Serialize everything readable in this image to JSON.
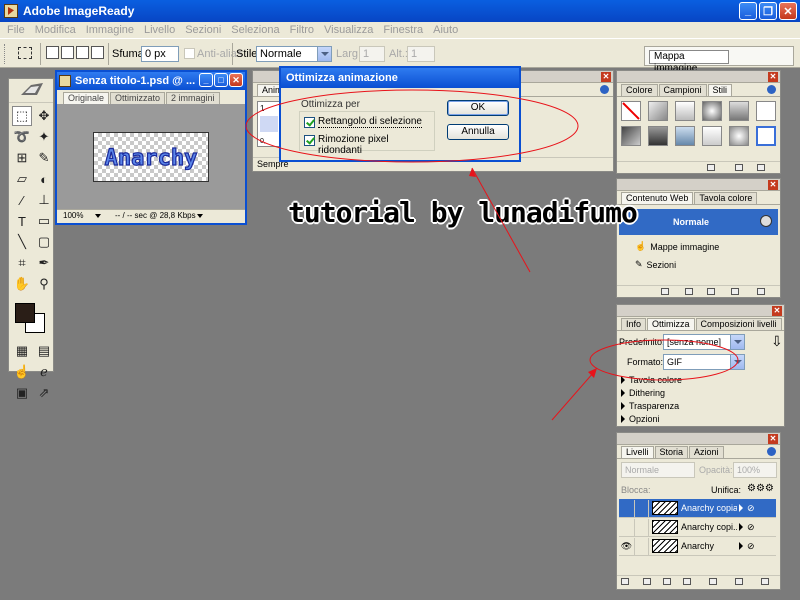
{
  "app": {
    "title": "Adobe ImageReady"
  },
  "menu": [
    "File",
    "Modifica",
    "Immagine",
    "Livello",
    "Sezioni",
    "Seleziona",
    "Filtro",
    "Visualizza",
    "Finestra",
    "Aiuto"
  ],
  "options_bar": {
    "feather_label": "Sfuma:",
    "feather_value": "0 px",
    "antialias_label": "Anti-alias",
    "style_label": "Stile:",
    "style_value": "Normale",
    "width_label": "Larg.:",
    "width_value": "1",
    "height_label": "Alt.:",
    "height_value": "1",
    "palette_well_tab": "Mappa immagine"
  },
  "document": {
    "title": "Senza titolo-1.psd @ ...",
    "tabs": [
      "Originale",
      "Ottimizzato",
      "2 immagini"
    ],
    "canvas_text": "Anarchy",
    "zoom": "100%",
    "status": "-- / -- sec @ 28,8 Kbps"
  },
  "animation_palette": {
    "tab": "Anim",
    "frame_number": "1",
    "loop": "Sempre",
    "delay": "0,"
  },
  "dialog": {
    "title": "Ottimizza animazione",
    "group_label": "Ottimizza per",
    "option1": "Rettangolo di selezione",
    "option2": "Rimozione pixel ridondanti",
    "option1_checked": true,
    "option2_checked": true,
    "ok": "OK",
    "cancel": "Annulla"
  },
  "overlay_text": "tutorial by lunadifumo",
  "color_palette": {
    "tabs": [
      "Colore",
      "Campioni",
      "Stili"
    ]
  },
  "web_palette": {
    "tabs": [
      "Contenuto Web",
      "Tavola colore"
    ],
    "header": "Normale",
    "items": [
      "Mappe immagine",
      "Sezioni"
    ]
  },
  "optimize_palette": {
    "tabs": [
      "Info",
      "Ottimizza",
      "Composizioni livelli"
    ],
    "preset_label": "Predefinito:",
    "preset_value": "[senza nome]",
    "format_label": "Formato:",
    "format_value": "GIF",
    "sections": [
      "Tavola colore",
      "Dithering",
      "Trasparenza",
      "Opzioni"
    ]
  },
  "layers_palette": {
    "tabs": [
      "Livelli",
      "Storia",
      "Azioni"
    ],
    "blend_mode": "Normale",
    "opacity_label": "Opacità:",
    "opacity_value": "100%",
    "lock_label": "Blocca:",
    "unify_label": "Unifica:",
    "layers": [
      {
        "name": "Anarchy copia"
      },
      {
        "name": "Anarchy copi..."
      },
      {
        "name": "Anarchy"
      }
    ]
  },
  "colors": {
    "accent": "#0a4fd2",
    "annotation": "#e8131a",
    "workspace": "#7b7b7b"
  }
}
